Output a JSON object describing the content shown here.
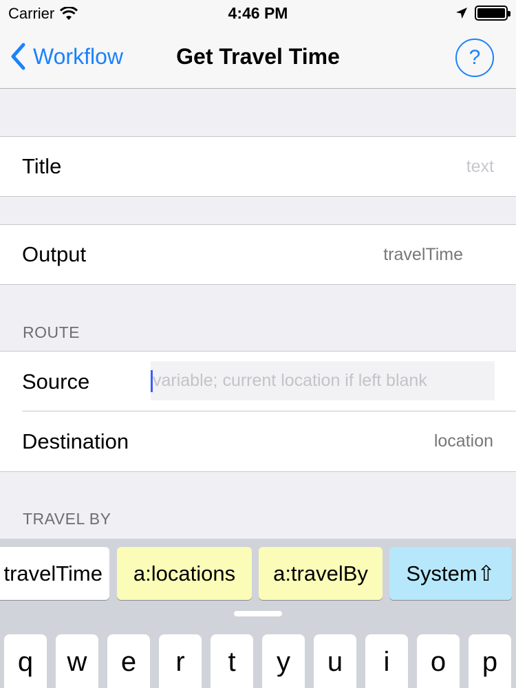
{
  "status_bar": {
    "carrier": "Carrier",
    "time": "4:46 PM"
  },
  "nav": {
    "back_label": "Workflow",
    "title": "Get Travel Time",
    "help_label": "?"
  },
  "fields": {
    "title": {
      "label": "Title",
      "placeholder": "text"
    },
    "output": {
      "label": "Output",
      "value": "travelTime"
    }
  },
  "route": {
    "header": "ROUTE",
    "source": {
      "label": "Source",
      "placeholder": "variable; current location if left blank"
    },
    "destination": {
      "label": "Destination",
      "placeholder": "location"
    }
  },
  "travel_by": {
    "header": "TRAVEL BY"
  },
  "suggestions": [
    "travelTime",
    "a:locations",
    "a:travelBy",
    "System⇧"
  ],
  "keyboard": {
    "row1": [
      "q",
      "w",
      "e",
      "r",
      "t",
      "y",
      "u",
      "i",
      "o",
      "p"
    ]
  },
  "colors": {
    "accent": "#1a82fb",
    "chip_yellow": "#fbfcb8",
    "chip_blue": "#b7e7fb",
    "caret": "#3a5cff"
  }
}
